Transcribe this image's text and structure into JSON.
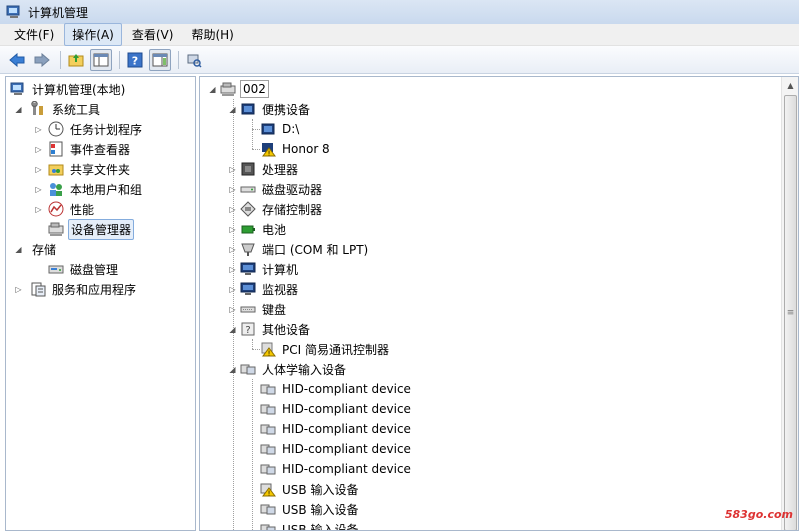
{
  "window": {
    "title": "计算机管理"
  },
  "menu": [
    {
      "label": "文件(F)"
    },
    {
      "label": "操作(A)",
      "active": true
    },
    {
      "label": "查看(V)"
    },
    {
      "label": "帮助(H)"
    }
  ],
  "left_tree": {
    "root": "计算机管理(本地)",
    "system_tools": "系统工具",
    "system_children": [
      "任务计划程序",
      "事件查看器",
      "共享文件夹",
      "本地用户和组",
      "性能",
      "设备管理器"
    ],
    "storage": "存储",
    "storage_children": [
      "磁盘管理"
    ],
    "services": "服务和应用程序"
  },
  "device_tree": {
    "root": "002",
    "portable": "便携设备",
    "portable_children": [
      "D:\\",
      "Honor 8"
    ],
    "categories": [
      "处理器",
      "磁盘驱动器",
      "存储控制器",
      "电池",
      "端口 (COM 和 LPT)",
      "计算机",
      "监视器",
      "键盘"
    ],
    "other": "其他设备",
    "other_children": [
      "PCI 简易通讯控制器"
    ],
    "hid": "人体学输入设备",
    "hid_children": [
      "HID-compliant device",
      "HID-compliant device",
      "HID-compliant device",
      "HID-compliant device",
      "HID-compliant device",
      "USB 输入设备",
      "USB 输入设备",
      "USB 输入设备"
    ]
  },
  "watermark": "583go.com"
}
